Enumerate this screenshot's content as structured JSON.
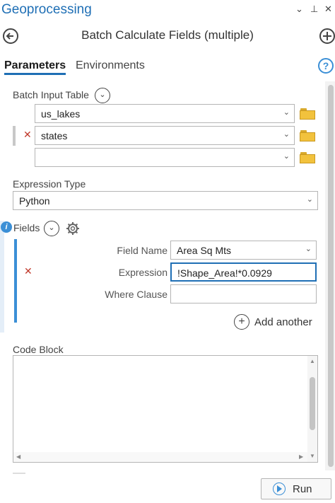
{
  "pane": {
    "title": "Geoprocessing",
    "controls": [
      "⌄",
      "⊥",
      "✕"
    ]
  },
  "tool": {
    "title": "Batch Calculate Fields (multiple)"
  },
  "tabs": [
    {
      "label": "Parameters",
      "active": true
    },
    {
      "label": "Environments",
      "active": false
    }
  ],
  "batch_input": {
    "label": "Batch Input Table",
    "rows": [
      {
        "value": "us_lakes",
        "removable": false
      },
      {
        "value": "states",
        "removable": true
      },
      {
        "value": "",
        "removable": false
      }
    ]
  },
  "expression_type": {
    "label": "Expression Type",
    "value": "Python"
  },
  "fields": {
    "label": "Fields",
    "field_name_label": "Field Name",
    "field_name_value": "Area Sq Mts",
    "expression_label": "Expression",
    "expression_value": "!Shape_Area!*0.0929",
    "where_label": "Where Clause",
    "where_value": "",
    "add_another": "Add another"
  },
  "code_block": {
    "label": "Code Block"
  },
  "run": {
    "label": "Run"
  },
  "colors": {
    "accent": "#1f6fb5",
    "remove": "#c0392b",
    "folder": "#f2c23d"
  },
  "icons": [
    "back-arrow-icon",
    "add-icon",
    "help-icon",
    "chevron-down-icon",
    "folder-icon",
    "remove-icon",
    "info-icon",
    "gear-icon",
    "play-icon"
  ]
}
